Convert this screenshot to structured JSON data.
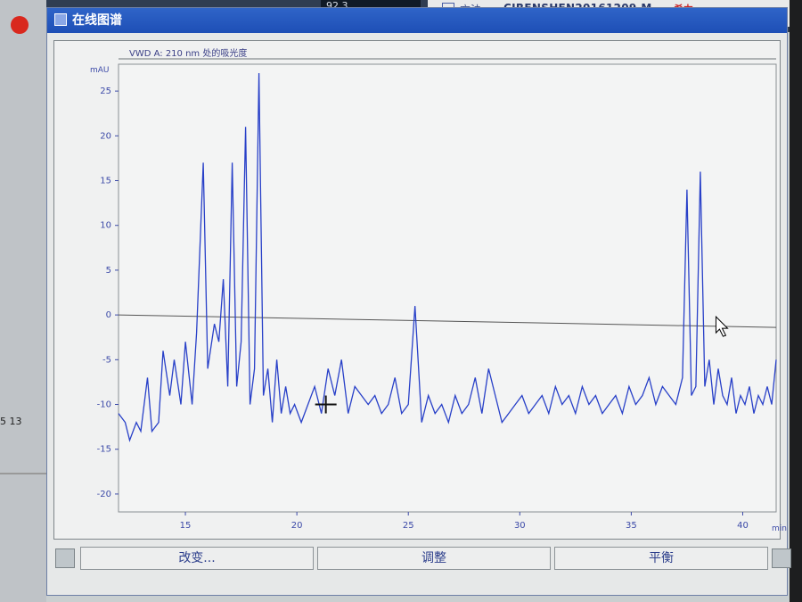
{
  "top_bar": {
    "value_readout": "92.3",
    "method_label": "方法:",
    "method_name": "CIRENSHEN20161209.M",
    "logo_text": "希力"
  },
  "sidebar": {
    "side_text": "5 13"
  },
  "window": {
    "title": "在线图谱",
    "buttons": [
      "_",
      "□",
      "×"
    ]
  },
  "plot": {
    "subtitle": "VWD A: 210 nm 处的吸光度",
    "y_unit": "mAU",
    "x_unit": "min"
  },
  "toolbar": {
    "change_label": "改变...",
    "adjust_label": "调整",
    "balance_label": "平衡"
  },
  "chart_data": {
    "type": "line",
    "title": "VWD A: 210 nm 处的吸光度",
    "xlabel": "min",
    "ylabel": "mAU",
    "xlim": [
      12,
      41.5
    ],
    "ylim": [
      -22,
      28
    ],
    "xticks": [
      15,
      20,
      25,
      30,
      35,
      40
    ],
    "yticks": [
      25,
      20,
      15,
      10,
      5,
      0,
      -5,
      -10,
      -15,
      -20
    ],
    "baseline_y": 0,
    "series": [
      {
        "color": "#2840c8",
        "x": [
          12.0,
          12.3,
          12.5,
          12.8,
          13.0,
          13.3,
          13.5,
          13.8,
          14.0,
          14.3,
          14.5,
          14.8,
          15.0,
          15.3,
          15.5,
          15.8,
          16.0,
          16.3,
          16.5,
          16.7,
          16.9,
          17.1,
          17.3,
          17.5,
          17.7,
          17.9,
          18.1,
          18.3,
          18.5,
          18.7,
          18.9,
          19.1,
          19.3,
          19.5,
          19.7,
          19.9,
          20.2,
          20.5,
          20.8,
          21.1,
          21.4,
          21.7,
          22.0,
          22.3,
          22.6,
          22.9,
          23.2,
          23.5,
          23.8,
          24.1,
          24.4,
          24.7,
          25.0,
          25.3,
          25.6,
          25.9,
          26.2,
          26.5,
          26.8,
          27.1,
          27.4,
          27.7,
          28.0,
          28.3,
          28.6,
          28.9,
          29.2,
          29.5,
          29.8,
          30.1,
          30.4,
          30.7,
          31.0,
          31.3,
          31.6,
          31.9,
          32.2,
          32.5,
          32.8,
          33.1,
          33.4,
          33.7,
          34.0,
          34.3,
          34.6,
          34.9,
          35.2,
          35.5,
          35.8,
          36.1,
          36.4,
          36.7,
          37.0,
          37.3,
          37.5,
          37.7,
          37.9,
          38.1,
          38.3,
          38.5,
          38.7,
          38.9,
          39.1,
          39.3,
          39.5,
          39.7,
          39.9,
          40.1,
          40.3,
          40.5,
          40.7,
          40.9,
          41.1,
          41.3,
          41.5
        ],
        "y": [
          -11,
          -12,
          -14,
          -12,
          -13,
          -7,
          -13,
          -12,
          -4,
          -9,
          -5,
          -10,
          -3,
          -10,
          -2,
          17,
          -6,
          -1,
          -3,
          4,
          -8,
          17,
          -8,
          -3,
          21,
          -10,
          -6,
          27,
          -9,
          -6,
          -12,
          -5,
          -11,
          -8,
          -11,
          -10,
          -12,
          -10,
          -8,
          -11,
          -6,
          -9,
          -5,
          -11,
          -8,
          -9,
          -10,
          -9,
          -11,
          -10,
          -7,
          -11,
          -10,
          1,
          -12,
          -9,
          -11,
          -10,
          -12,
          -9,
          -11,
          -10,
          -7,
          -11,
          -6,
          -9,
          -12,
          -11,
          -10,
          -9,
          -11,
          -10,
          -9,
          -11,
          -8,
          -10,
          -9,
          -11,
          -8,
          -10,
          -9,
          -11,
          -10,
          -9,
          -11,
          -8,
          -10,
          -9,
          -7,
          -10,
          -8,
          -9,
          -10,
          -7,
          14,
          -9,
          -8,
          16,
          -8,
          -5,
          -10,
          -6,
          -9,
          -10,
          -7,
          -11,
          -9,
          -10,
          -8,
          -11,
          -9,
          -10,
          -8,
          -10,
          -5
        ]
      }
    ]
  }
}
